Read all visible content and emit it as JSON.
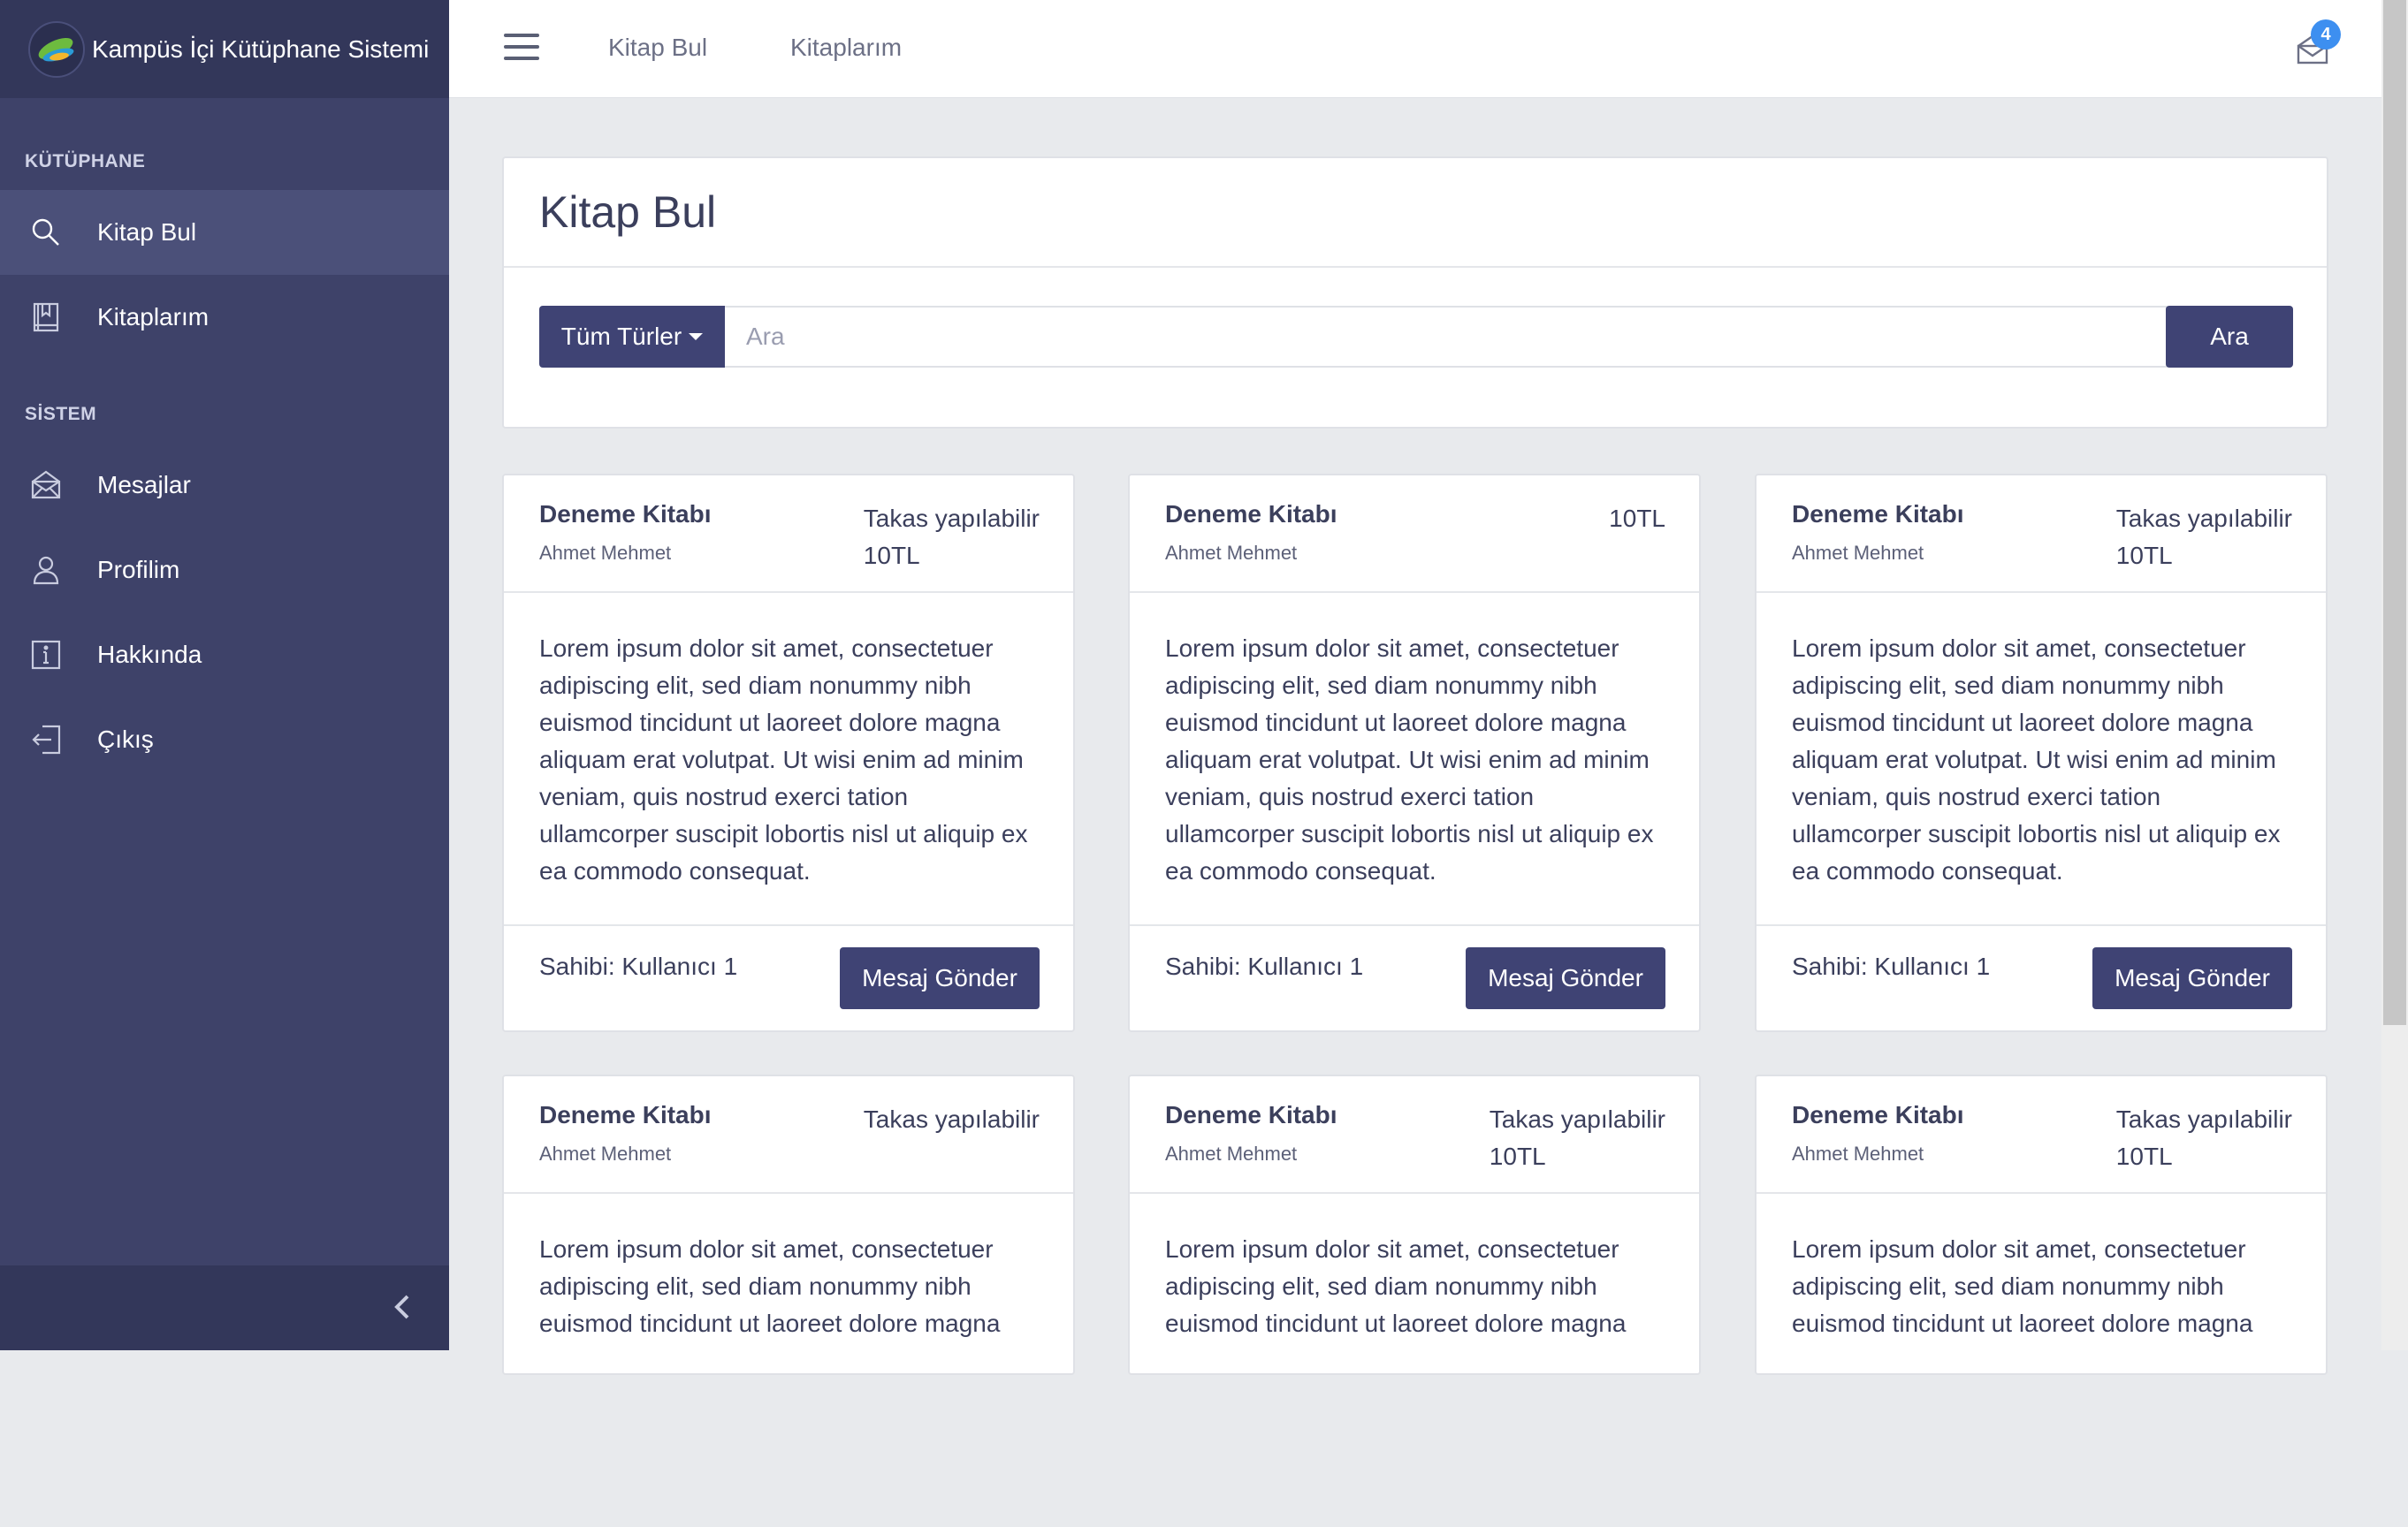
{
  "app": {
    "title": "Kampüs İçi Kütüphane Sistemi"
  },
  "sidebar": {
    "section_library": "KÜTÜPHANE",
    "section_system": "SİSTEM",
    "items": [
      {
        "label": "Kitap Bul",
        "icon": "search-icon",
        "active": true
      },
      {
        "label": "Kitaplarım",
        "icon": "book-icon"
      },
      {
        "label": "Mesajlar",
        "icon": "envelope-icon"
      },
      {
        "label": "Profilim",
        "icon": "user-icon"
      },
      {
        "label": "Hakkında",
        "icon": "info-icon"
      },
      {
        "label": "Çıkış",
        "icon": "logout-icon"
      }
    ]
  },
  "topbar": {
    "links": [
      "Kitap Bul",
      "Kitaplarım"
    ],
    "notification_count": "4"
  },
  "main": {
    "page_title": "Kitap Bul",
    "search": {
      "type_label": "Tüm Türler",
      "placeholder": "Ara",
      "button": "Ara"
    }
  },
  "cards": [
    {
      "title": "Deneme Kitabı",
      "author": "Ahmet Mehmet",
      "meta": [
        "Takas yapılabilir",
        "10TL"
      ],
      "description": "Lorem ipsum dolor sit amet, consectetuer adipiscing elit, sed diam nonummy nibh euismod tincidunt ut laoreet dolore magna aliquam erat volutpat. Ut wisi enim ad minim veniam, quis nostrud exerci tation ullamcorper suscipit lobortis nisl ut aliquip ex ea commodo consequat.",
      "owner": "Sahibi: Kullanıcı 1",
      "button": "Mesaj Gönder"
    },
    {
      "title": "Deneme Kitabı",
      "author": "Ahmet Mehmet",
      "meta": [
        "10TL"
      ],
      "description": "Lorem ipsum dolor sit amet, consectetuer adipiscing elit, sed diam nonummy nibh euismod tincidunt ut laoreet dolore magna aliquam erat volutpat. Ut wisi enim ad minim veniam, quis nostrud exerci tation ullamcorper suscipit lobortis nisl ut aliquip ex ea commodo consequat.",
      "owner": "Sahibi: Kullanıcı 1",
      "button": "Mesaj Gönder"
    },
    {
      "title": "Deneme Kitabı",
      "author": "Ahmet Mehmet",
      "meta": [
        "Takas yapılabilir",
        "10TL"
      ],
      "description": "Lorem ipsum dolor sit amet, consectetuer adipiscing elit, sed diam nonummy nibh euismod tincidunt ut laoreet dolore magna aliquam erat volutpat. Ut wisi enim ad minim veniam, quis nostrud exerci tation ullamcorper suscipit lobortis nisl ut aliquip ex ea commodo consequat.",
      "owner": "Sahibi: Kullanıcı 1",
      "button": "Mesaj Gönder"
    },
    {
      "title": "Deneme Kitabı",
      "author": "Ahmet Mehmet",
      "meta": [
        "Takas yapılabilir"
      ],
      "description": "Lorem ipsum dolor sit amet, consectetuer adipiscing elit, sed diam nonummy nibh euismod tincidunt ut laoreet dolore magna",
      "owner": "",
      "button": ""
    },
    {
      "title": "Deneme Kitabı",
      "author": "Ahmet Mehmet",
      "meta": [
        "Takas yapılabilir",
        "10TL"
      ],
      "description": "Lorem ipsum dolor sit amet, consectetuer adipiscing elit, sed diam nonummy nibh euismod tincidunt ut laoreet dolore magna",
      "owner": "",
      "button": ""
    },
    {
      "title": "Deneme Kitabı",
      "author": "Ahmet Mehmet",
      "meta": [
        "Takas yapılabilir",
        "10TL"
      ],
      "description": "Lorem ipsum dolor sit amet, consectetuer adipiscing elit, sed diam nonummy nibh euismod tincidunt ut laoreet dolore magna",
      "owner": "",
      "button": ""
    }
  ],
  "colors": {
    "sidebar": "#3e4269",
    "brand_bar": "#33375a",
    "accent": "#3f4374",
    "badge": "#3d8ff0"
  }
}
